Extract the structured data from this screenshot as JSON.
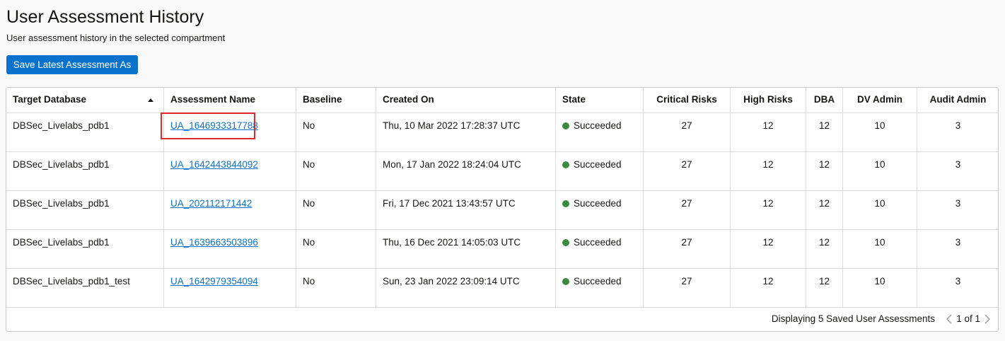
{
  "page": {
    "title": "User Assessment History",
    "subtitle": "User assessment history in the selected compartment",
    "save_button": "Save Latest Assessment As"
  },
  "table": {
    "columns": {
      "target_database": "Target Database",
      "assessment_name": "Assessment Name",
      "baseline": "Baseline",
      "created_on": "Created On",
      "state": "State",
      "critical_risks": "Critical Risks",
      "high_risks": "High Risks",
      "dba": "DBA",
      "dv_admin": "DV Admin",
      "audit_admin": "Audit Admin"
    },
    "sorted_column": "target_database",
    "sort_direction": "ascending",
    "rows": [
      {
        "target_database": "DBSec_Livelabs_pdb1",
        "assessment_name": "UA_1646933317788",
        "baseline": "No",
        "created_on": "Thu, 10 Mar 2022 17:28:37 UTC",
        "state": "Succeeded",
        "critical_risks": "27",
        "high_risks": "12",
        "dba": "12",
        "dv_admin": "10",
        "audit_admin": "3"
      },
      {
        "target_database": "DBSec_Livelabs_pdb1",
        "assessment_name": "UA_1642443844092",
        "baseline": "No",
        "created_on": "Mon, 17 Jan 2022 18:24:04 UTC",
        "state": "Succeeded",
        "critical_risks": "27",
        "high_risks": "12",
        "dba": "12",
        "dv_admin": "10",
        "audit_admin": "3"
      },
      {
        "target_database": "DBSec_Livelabs_pdb1",
        "assessment_name": "UA_202112171442",
        "baseline": "No",
        "created_on": "Fri, 17 Dec 2021 13:43:57 UTC",
        "state": "Succeeded",
        "critical_risks": "27",
        "high_risks": "12",
        "dba": "12",
        "dv_admin": "10",
        "audit_admin": "3"
      },
      {
        "target_database": "DBSec_Livelabs_pdb1",
        "assessment_name": "UA_1639663503896",
        "baseline": "No",
        "created_on": "Thu, 16 Dec 2021 14:05:03 UTC",
        "state": "Succeeded",
        "critical_risks": "27",
        "high_risks": "12",
        "dba": "12",
        "dv_admin": "10",
        "audit_admin": "3"
      },
      {
        "target_database": "DBSec_Livelabs_pdb1_test",
        "assessment_name": "UA_1642979354094",
        "baseline": "No",
        "created_on": "Sun, 23 Jan 2022 23:09:14 UTC",
        "state": "Succeeded",
        "critical_risks": "27",
        "high_risks": "12",
        "dba": "12",
        "dv_admin": "10",
        "audit_admin": "3"
      }
    ]
  },
  "footer": {
    "summary": "Displaying 5 Saved User Assessments",
    "page_info": "1 of 1"
  },
  "colors": {
    "accent": "#0a72cc",
    "success": "#3a8a3e",
    "highlight": "#e0272d"
  },
  "icons": {
    "sort": "sort-ascending-icon",
    "status": "status-dot-icon",
    "previous": "chevron-left-icon",
    "next": "chevron-right-icon"
  }
}
